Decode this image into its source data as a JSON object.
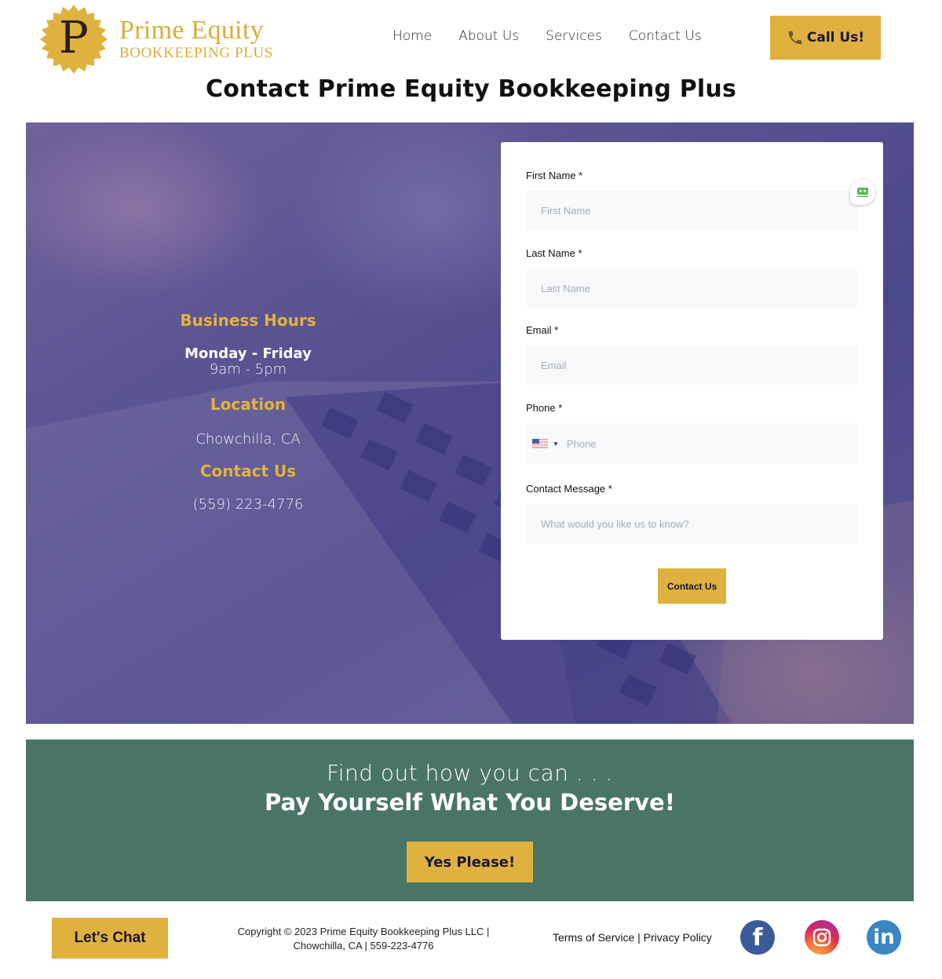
{
  "brand": {
    "logo_letter": "P",
    "name": "Prime Equity",
    "tagline": "BOOKKEEPING PLUS",
    "accent_color": "#dfb13e",
    "green_color": "#4a7564",
    "navy_text_color": "#1b1533"
  },
  "nav": {
    "items": [
      {
        "label": "Home"
      },
      {
        "label": "About Us"
      },
      {
        "label": "Services"
      },
      {
        "label": "Contact Us"
      }
    ],
    "call_button": {
      "label": "Call Us!",
      "icon": "phone-icon"
    }
  },
  "page": {
    "title": "Contact Prime Equity Bookkeeping Plus"
  },
  "info": {
    "hours_heading": "Business Hours",
    "days": "Monday - Friday",
    "hours": "9am - 5pm",
    "location_heading": "Location",
    "location": "Chowchilla, CA",
    "contact_heading": "Contact Us",
    "phone": "(559) 223-4776"
  },
  "form": {
    "fields": [
      {
        "label": "First Name *",
        "placeholder": "First Name",
        "value": ""
      },
      {
        "label": "Last Name *",
        "placeholder": "Last Name",
        "value": ""
      },
      {
        "label": "Email *",
        "placeholder": "Email",
        "value": ""
      },
      {
        "label": "Phone *",
        "placeholder": "Phone",
        "value": "",
        "country": "US"
      },
      {
        "label": "Contact Message *",
        "placeholder": "What would you like us to know?",
        "value": ""
      }
    ],
    "submit_label": "Contact Us",
    "password_manager_icon": "password-manager-icon"
  },
  "cta": {
    "line1": "Find out how you can . . .",
    "line2": "Pay Yourself What You Deserve!",
    "button_label": "Yes Please!"
  },
  "footer": {
    "chat_button": "Let's Chat",
    "copyright_line1": "Copyright © 2023 Prime Equity Bookkeeping Plus LLC |",
    "copyright_line2": "Chowchilla, CA | 559-223-4776",
    "terms": "Terms of Service",
    "separator": " | ",
    "privacy": "Privacy Policy",
    "social": [
      {
        "name": "facebook",
        "glyph": "f"
      },
      {
        "name": "instagram",
        "glyph": ""
      },
      {
        "name": "linkedin",
        "glyph": "in"
      }
    ]
  }
}
